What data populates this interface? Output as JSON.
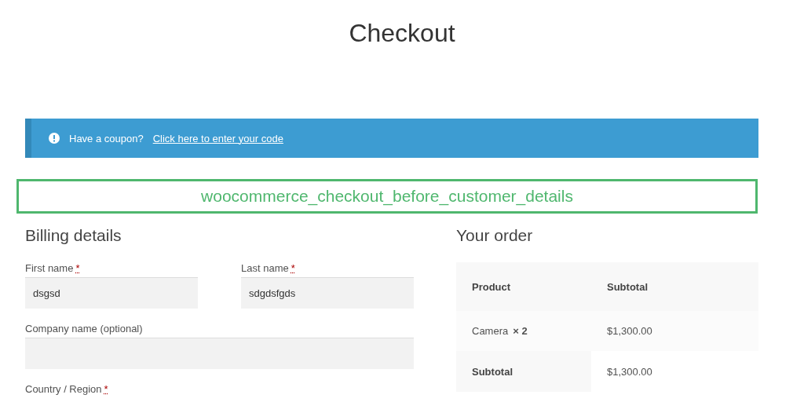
{
  "page_title": "Checkout",
  "notice": {
    "text": "Have a coupon?",
    "link": "Click here to enter your code"
  },
  "hook_label": "woocommerce_checkout_before_customer_details",
  "billing": {
    "heading": "Billing details",
    "fields": [
      {
        "label": "First name",
        "required": "*",
        "value": "dsgsd",
        "kind": "half"
      },
      {
        "label": "Last name",
        "required": "*",
        "value": "sdgdsfgds",
        "kind": "half"
      },
      {
        "label": "Company name (optional)",
        "kind": "full"
      },
      {
        "label": "Country / Region",
        "required": "*",
        "kind": "label"
      }
    ]
  },
  "order": {
    "heading": "Your order",
    "columns": [
      "Product",
      "Subtotal"
    ],
    "items": [
      {
        "name": "Camera",
        "quantity": "× 2",
        "subtotal": "$1,300.00"
      }
    ],
    "totals": [
      {
        "label": "Subtotal",
        "value": "$1,300.00"
      }
    ]
  }
}
